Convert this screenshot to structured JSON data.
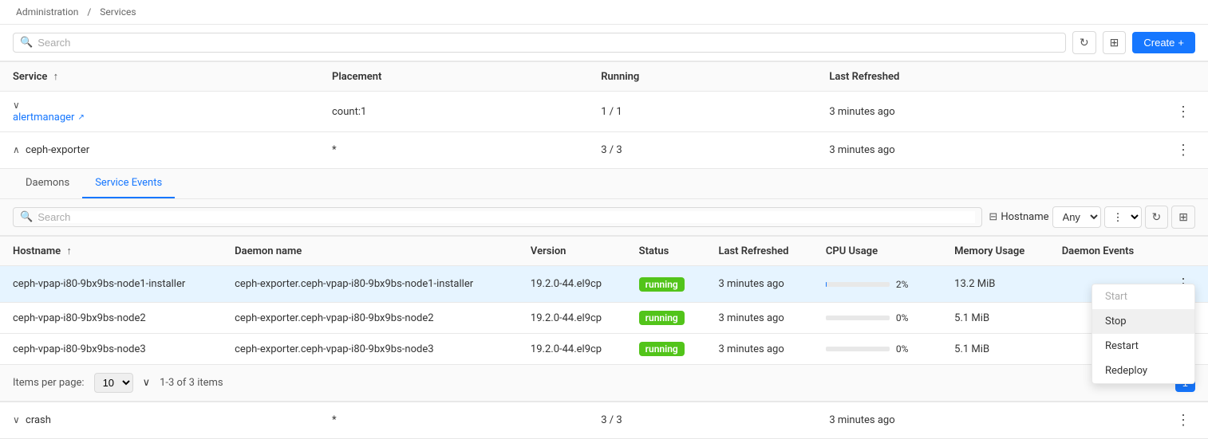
{
  "breadcrumb": {
    "admin": "Administration",
    "sep": "/",
    "current": "Services"
  },
  "top_toolbar": {
    "search_placeholder": "Search",
    "refresh_icon": "↻",
    "save_icon": "⊞",
    "create_label": "Create",
    "create_icon": "+"
  },
  "main_table": {
    "columns": [
      {
        "key": "service",
        "label": "Service",
        "sortable": true
      },
      {
        "key": "placement",
        "label": "Placement"
      },
      {
        "key": "running",
        "label": "Running"
      },
      {
        "key": "last_refreshed",
        "label": "Last Refreshed"
      }
    ],
    "rows": [
      {
        "id": "alertmanager",
        "service": "alertmanager",
        "service_link": true,
        "expanded": true,
        "placement": "count:1",
        "running": "1 / 1",
        "last_refreshed": "3 minutes ago"
      },
      {
        "id": "ceph-exporter",
        "service": "ceph-exporter",
        "service_link": false,
        "expanded": true,
        "placement": "*",
        "running": "3 / 3",
        "last_refreshed": "3 minutes ago"
      },
      {
        "id": "crash",
        "service": "crash",
        "service_link": false,
        "expanded": false,
        "placement": "*",
        "running": "3 / 3",
        "last_refreshed": "3 minutes ago"
      }
    ]
  },
  "tabs": {
    "items": [
      {
        "label": "Daemons",
        "active": false
      },
      {
        "label": "Service Events",
        "active": true
      }
    ]
  },
  "sub_table": {
    "search_placeholder": "Search",
    "filter_icon": "⊟",
    "hostname_label": "Hostname",
    "any_label": "Any",
    "columns": [
      {
        "key": "hostname",
        "label": "Hostname",
        "sortable": true
      },
      {
        "key": "daemon_name",
        "label": "Daemon name"
      },
      {
        "key": "version",
        "label": "Version"
      },
      {
        "key": "status",
        "label": "Status"
      },
      {
        "key": "last_refreshed",
        "label": "Last Refreshed"
      },
      {
        "key": "cpu_usage",
        "label": "CPU Usage"
      },
      {
        "key": "memory_usage",
        "label": "Memory Usage"
      },
      {
        "key": "daemon_events",
        "label": "Daemon Events"
      }
    ],
    "rows": [
      {
        "id": "row1",
        "hostname": "ceph-vpap-i80-9bx9bs-node1-installer",
        "daemon_name": "ceph-exporter.ceph-vpap-i80-9bx9bs-node1-installer",
        "version": "19.2.0-44.el9cp",
        "status": "running",
        "last_refreshed": "3 minutes ago",
        "cpu_pct": 2,
        "cpu_label": "2%",
        "memory": "13.2 MiB",
        "highlighted": true
      },
      {
        "id": "row2",
        "hostname": "ceph-vpap-i80-9bx9bs-node2",
        "daemon_name": "ceph-exporter.ceph-vpap-i80-9bx9bs-node2",
        "version": "19.2.0-44.el9cp",
        "status": "running",
        "last_refreshed": "3 minutes ago",
        "cpu_pct": 0,
        "cpu_label": "0%",
        "memory": "5.1 MiB",
        "highlighted": false
      },
      {
        "id": "row3",
        "hostname": "ceph-vpap-i80-9bx9bs-node3",
        "daemon_name": "ceph-exporter.ceph-vpap-i80-9bx9bs-node3",
        "version": "19.2.0-44.el9cp",
        "status": "running",
        "last_refreshed": "3 minutes ago",
        "cpu_pct": 0,
        "cpu_label": "0%",
        "memory": "5.1 MiB",
        "highlighted": false
      }
    ]
  },
  "pagination": {
    "items_per_page_label": "Items per page:",
    "per_page_value": "10",
    "range_label": "1-3 of 3 items",
    "page_current": "1"
  },
  "context_menu": {
    "items": [
      {
        "label": "Start",
        "disabled": true
      },
      {
        "label": "Stop",
        "disabled": false,
        "active": true
      },
      {
        "label": "Restart",
        "disabled": false
      },
      {
        "label": "Redeploy",
        "disabled": false
      }
    ]
  }
}
